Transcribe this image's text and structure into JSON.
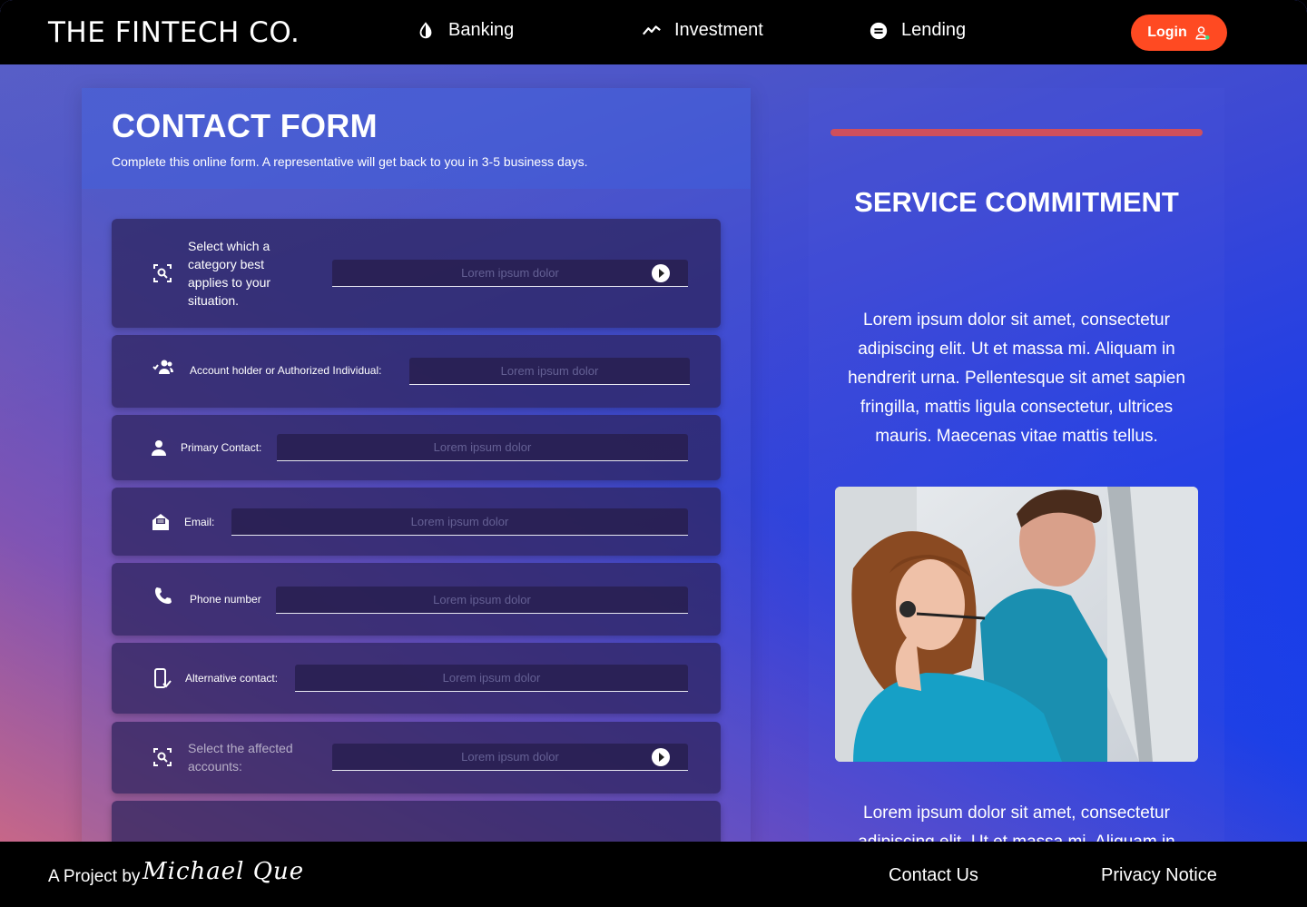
{
  "nav": {
    "brand": "THE FINTECH CO.",
    "items": [
      {
        "label": "Banking",
        "icon": "contrast-drop-icon"
      },
      {
        "label": "Investment",
        "icon": "trending-line-icon"
      },
      {
        "label": "Lending",
        "icon": "cash-coin-icon"
      }
    ],
    "login_label": "Login"
  },
  "form": {
    "title": "CONTACT FORM",
    "subtitle": "Complete this online form. A representative will get back to you in 3-5 business days.",
    "placeholder": "Lorem ipsum dolor",
    "rows": [
      {
        "label": "Select which a category best applies to your situation.",
        "icon": "scan-search-icon",
        "type": "select"
      },
      {
        "label": "Account holder or Authorized Individual:",
        "icon": "group-check-icon",
        "type": "input"
      },
      {
        "label": "Primary Contact:",
        "icon": "person-icon",
        "type": "input"
      },
      {
        "label": "Email:",
        "icon": "mail-icon",
        "type": "input"
      },
      {
        "label": "Phone number",
        "icon": "phone-icon",
        "type": "input"
      },
      {
        "label": "Alternative contact:",
        "icon": "mobile-check-icon",
        "type": "input"
      },
      {
        "label": "Select the affected accounts:",
        "icon": "scan-search-icon",
        "type": "select"
      }
    ]
  },
  "service": {
    "title": "SERVICE COMMITMENT",
    "text": "Lorem ipsum dolor sit amet, consectetur adipiscing elit. Ut et massa mi. Aliquam in hendrerit urna. Pellentesque sit amet sapien fringilla, mattis ligula consectetur, ultrices mauris. Maecenas vitae mattis tellus.",
    "text2": "Lorem ipsum dolor sit amet, consectetur adipiscing elit. Ut et massa mi. Aliquam in",
    "accent_color": "#cf4f5c"
  },
  "footer": {
    "credit": "A Project by",
    "signature": "Michael Que",
    "links": [
      "Contact Us",
      "Privacy Notice"
    ]
  },
  "colors": {
    "login": "#ff4a22",
    "nav_bg": "#000000"
  }
}
